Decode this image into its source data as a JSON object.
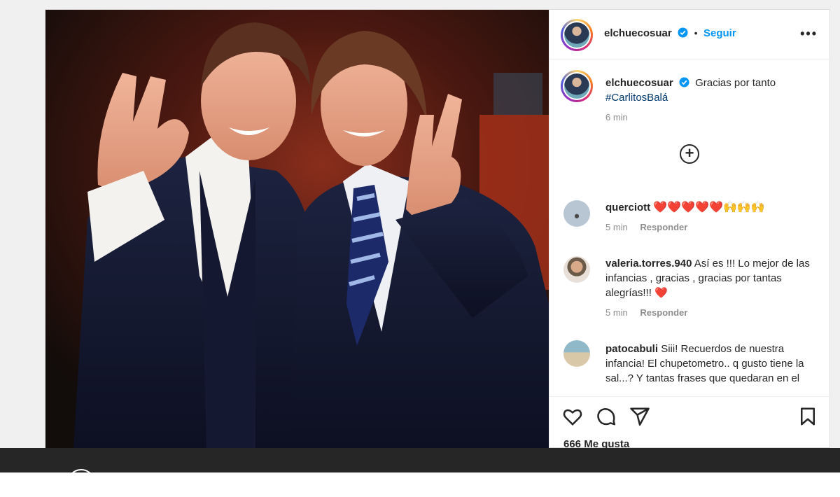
{
  "header": {
    "username": "elchuecosuar",
    "dot": "•",
    "follow_label": "Seguir",
    "more_label": "•••"
  },
  "caption": {
    "username": "elchuecosuar",
    "text": "Gracias por tanto",
    "hashtag": "#CarlitosBalá",
    "time": "6 min"
  },
  "comments": [
    {
      "username": "querciott",
      "text": "❤️❤️❤️❤️❤️🙌🙌🙌",
      "time": "5 min",
      "reply": "Responder"
    },
    {
      "username": "valeria.torres.940",
      "text": "Así es !!! Lo mejor de las infancias , gracias , gracias por tantas alegrías!!! ❤️",
      "time": "5 min",
      "reply": "Responder"
    },
    {
      "username": "patocabuli",
      "text": "Siii! Recuerdos de nuestra infancia! El chupetometro.. q gusto tiene la sal...? Y tantas frases que quedaran en el",
      "time": "",
      "reply": ""
    }
  ],
  "likes": "666 Me gusta",
  "icons": [
    "heart-icon",
    "comment-icon",
    "share-icon",
    "bookmark-icon",
    "verified-icon",
    "add-comment-icon"
  ],
  "colors": {
    "accent": "#0095f6",
    "verified": "#0095f6",
    "heart": "#ed1c24",
    "hashtag": "#00376b"
  }
}
